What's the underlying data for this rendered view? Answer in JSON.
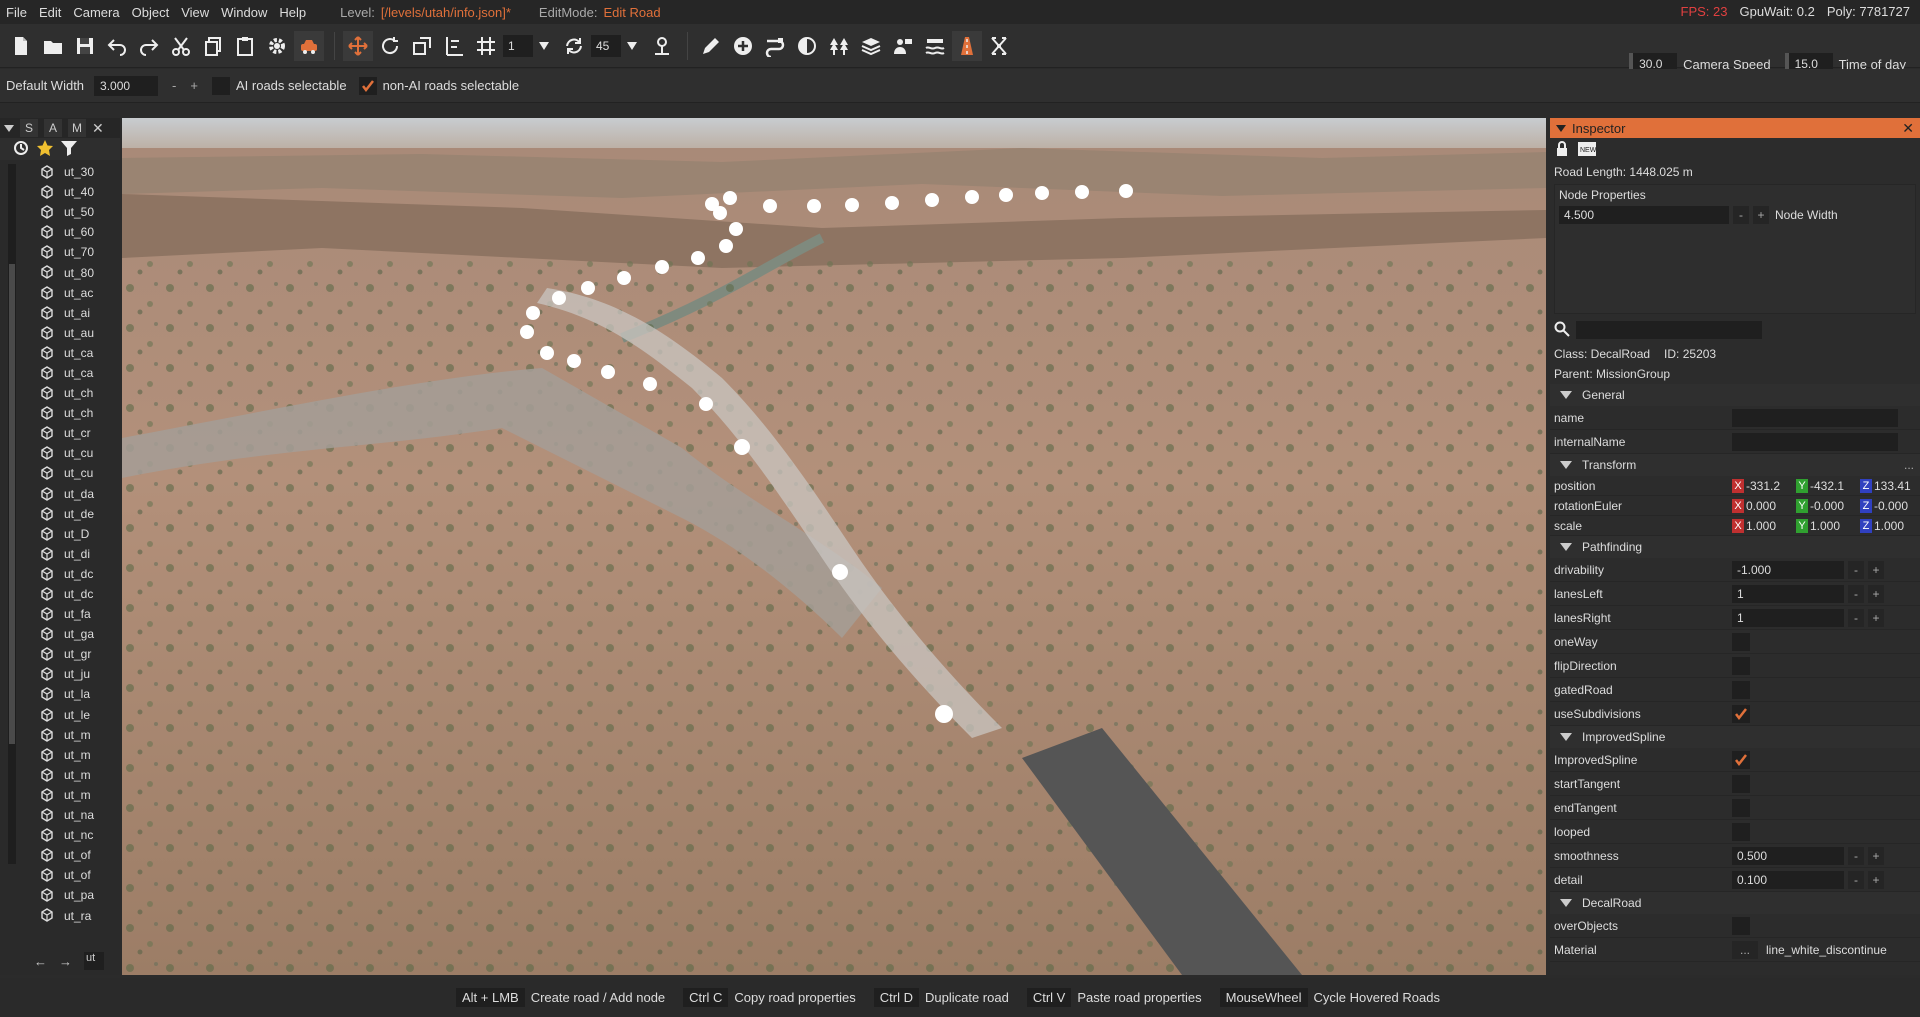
{
  "menubar": {
    "items": [
      "File",
      "Edit",
      "Camera",
      "Object",
      "View",
      "Window",
      "Help"
    ],
    "level_label": "Level:",
    "level_value": "[/levels/utah/info.json]*",
    "editmode_label": "EditMode:",
    "editmode_value": "Edit Road",
    "fps": "FPS: 23",
    "gpuwait": "GpuWait: 0.2",
    "poly": "Poly: 7781727"
  },
  "toolbar": {
    "snap_value": "1",
    "angle_value": "45",
    "camera_speed_value": "30.0",
    "camera_speed_label": "Camera Speed",
    "time_value": "15.0",
    "time_label": "Time of day"
  },
  "options": {
    "default_width_label": "Default Width",
    "default_width_value": "3.000",
    "minus": "-",
    "plus": "+",
    "ai_roads_label": "AI roads selectable",
    "ai_roads_checked": false,
    "non_ai_roads_label": "non-AI roads selectable",
    "non_ai_roads_checked": true
  },
  "left_panel": {
    "tabs": [
      "S",
      "A",
      "M"
    ],
    "items": [
      "ut_30",
      "ut_40",
      "ut_50",
      "ut_60",
      "ut_70",
      "ut_80",
      "ut_ac",
      "ut_ai",
      "ut_au",
      "ut_ca",
      "ut_ca",
      "ut_ch",
      "ut_ch",
      "ut_cr",
      "ut_cu",
      "ut_cu",
      "ut_da",
      "ut_de",
      "ut_D",
      "ut_di",
      "ut_dc",
      "ut_dc",
      "ut_fa",
      "ut_ga",
      "ut_gr",
      "ut_ju",
      "ut_la",
      "ut_le",
      "ut_m",
      "ut_m",
      "ut_m",
      "ut_m",
      "ut_na",
      "ut_nc",
      "ut_of",
      "ut_of",
      "ut_pa",
      "ut_ra"
    ],
    "bottom_input": "ut"
  },
  "inspector": {
    "title": "Inspector",
    "road_length": "Road Length: 1448.025 m",
    "node_properties_label": "Node Properties",
    "node_width_value": "4.500",
    "node_width_label": "Node Width",
    "search_placeholder": "",
    "class_line": "Class:  DecalRoad",
    "id_line": "ID:  25203",
    "parent_line": "Parent:  MissionGroup",
    "sections": {
      "general": "General",
      "transform": "Transform",
      "pathfinding": "Pathfinding",
      "improved_spline": "ImprovedSpline",
      "decal_road": "DecalRoad"
    },
    "general": {
      "name_label": "name",
      "name_value": "",
      "internal_name_label": "internalName",
      "internal_name_value": ""
    },
    "transform": {
      "position_label": "position",
      "position": [
        "-331.2",
        "-432.1",
        "133.41"
      ],
      "rotation_label": "rotationEuler",
      "rotation": [
        "0.000",
        "-0.000",
        "-0.000"
      ],
      "scale_label": "scale",
      "scale": [
        "1.000",
        "1.000",
        "1.000"
      ]
    },
    "pathfinding": {
      "drivability_label": "drivability",
      "drivability_value": "-1.000",
      "lanes_left_label": "lanesLeft",
      "lanes_left_value": "1",
      "lanes_right_label": "lanesRight",
      "lanes_right_value": "1",
      "one_way_label": "oneWay",
      "one_way": false,
      "flip_direction_label": "flipDirection",
      "flip_direction": false,
      "gated_road_label": "gatedRoad",
      "gated_road": false,
      "use_subdivisions_label": "useSubdivisions",
      "use_subdivisions": true
    },
    "improved_spline": {
      "improved_spline_label": "ImprovedSpline",
      "improved_spline": true,
      "start_tangent_label": "startTangent",
      "start_tangent": false,
      "end_tangent_label": "endTangent",
      "end_tangent": false,
      "looped_label": "looped",
      "looped": false,
      "smoothness_label": "smoothness",
      "smoothness_value": "0.500",
      "detail_label": "detail",
      "detail_value": "0.100"
    },
    "decal_road": {
      "over_objects_label": "overObjects",
      "over_objects": false,
      "material_label": "Material",
      "material_value": "line_white_discontinue",
      "material_button": "..."
    }
  },
  "hints": [
    {
      "key": "Alt + LMB",
      "desc": "Create road / Add node"
    },
    {
      "key": "Ctrl C",
      "desc": "Copy road properties"
    },
    {
      "key": "Ctrl D",
      "desc": "Duplicate road"
    },
    {
      "key": "Ctrl V",
      "desc": "Paste road properties"
    },
    {
      "key": "MouseWheel",
      "desc": "Cycle Hovered Roads"
    }
  ],
  "colors": {
    "accent": "#e0703a",
    "background": "#2b2b2b",
    "field": "#1f1f1f",
    "fps": "#e04040"
  }
}
